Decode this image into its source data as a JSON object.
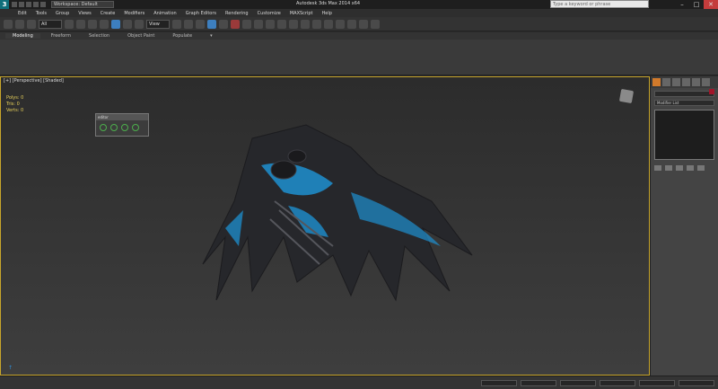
{
  "titlebar": {
    "workspace": "Workspace: Default",
    "app_title": "Autodesk 3ds Max 2014 x64",
    "search_placeholder": "Type a keyword or phrase"
  },
  "menu": [
    "Edit",
    "Tools",
    "Group",
    "Views",
    "Create",
    "Modifiers",
    "Animation",
    "Graph Editors",
    "Rendering",
    "Customize",
    "MAXScript",
    "Help"
  ],
  "toolbar": {
    "selection_filter": "All",
    "view_dropdown": "View"
  },
  "ribbon": {
    "tabs": [
      "Modeling",
      "Freeform",
      "Selection",
      "Object Paint",
      "Populate"
    ]
  },
  "viewport": {
    "label": "[+] [Perspective] [Shaded]",
    "stats": {
      "polys_label": "Polys:",
      "polys": "0",
      "tris_label": "Tris:",
      "tris": "0",
      "verts_label": "Verts:",
      "verts": "0"
    },
    "floater_title": "editor",
    "colors": {
      "border": "#c7a52b",
      "model_dark": "#2b2b30",
      "model_accent": "#1e90d0"
    }
  },
  "command_panel": {
    "object_name": "",
    "dropdown": "Modifier List",
    "accent": "#d27a2b"
  }
}
